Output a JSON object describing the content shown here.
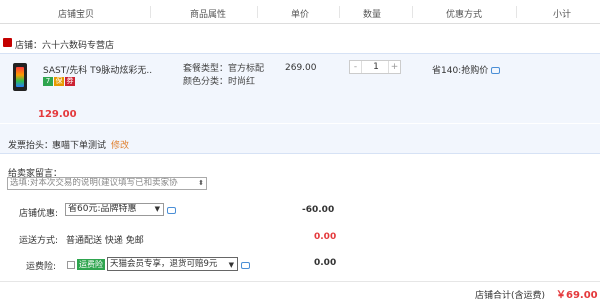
{
  "header": {
    "columns": [
      "店铺宝贝",
      "商品属性",
      "单价",
      "数量",
      "优惠方式",
      "小计"
    ]
  },
  "shop": {
    "name": "店铺：六十六数码专营店"
  },
  "item": {
    "title": "SAST/先科 T9脉动炫彩无...",
    "badges": [
      "7",
      "保",
      "券"
    ],
    "sku_type": "套餐类型：官方标配",
    "sku_color": "颜色分类：时尚红",
    "unit_price": "269.00",
    "quantity": "1",
    "qty_minus": "-",
    "qty_plus": "+",
    "promo": "省140:抢购价",
    "subtotal": "129.00"
  },
  "invoice": {
    "label": "发票抬头：",
    "value": "惠喵下单测试",
    "edit": "修改"
  },
  "message": {
    "label": "给卖家留言：",
    "placeholder": "选填:对本次交易的说明(建议填写已和卖家协",
    "arrow": "⬍"
  },
  "shop_discount": {
    "label": "店铺优惠:",
    "option": "省60元:品牌特惠",
    "amount": "-60.00"
  },
  "shipping": {
    "label": "运送方式:",
    "method": "普通配送 快递 免邮",
    "amount": "0.00"
  },
  "insurance": {
    "label": "运费险:",
    "badge": "运费险",
    "option": "天猫会员专享，退货可赔9元",
    "amount": "0.00"
  },
  "total": {
    "label": "店铺合计(含运费)",
    "value": "￥69.00"
  },
  "colors": {
    "accent_red": "#e4393c",
    "link_orange": "#e08030",
    "panel_blue": "#f2f6fd"
  }
}
